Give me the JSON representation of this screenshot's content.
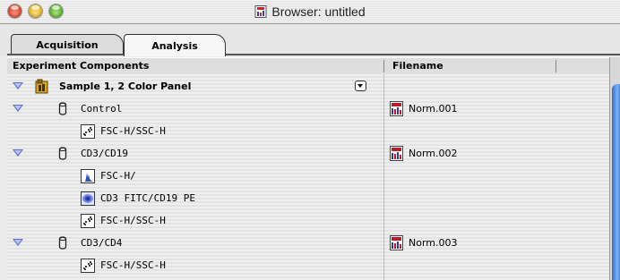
{
  "window": {
    "title": "Browser: untitled",
    "controls": [
      "close",
      "minimize",
      "zoom"
    ]
  },
  "tabs": [
    {
      "label": "Acquisition",
      "selected": false
    },
    {
      "label": "Analysis",
      "selected": true
    }
  ],
  "table": {
    "columns": [
      "Experiment Components",
      "Filename"
    ],
    "rows": [
      {
        "label": "Sample 1, 2 Color Panel",
        "icon": "experiment-folder-icon",
        "disclosure": true,
        "bold": true,
        "has_popup": true,
        "file": ""
      },
      {
        "label": "Control",
        "icon": "tube-icon",
        "disclosure": true,
        "file": "Norm.001",
        "file_icon": "fcs-file-icon"
      },
      {
        "label": "FSC-H/SSC-H",
        "icon": "dot-plot-icon",
        "disclosure": false,
        "file": ""
      },
      {
        "label": "CD3/CD19",
        "icon": "tube-icon",
        "disclosure": true,
        "file": "Norm.002",
        "file_icon": "fcs-file-icon"
      },
      {
        "label": "FSC-H/",
        "icon": "histogram-icon",
        "disclosure": false,
        "file": ""
      },
      {
        "label": "CD3 FITC/CD19 PE",
        "icon": "contour-plot-icon",
        "disclosure": false,
        "file": ""
      },
      {
        "label": "FSC-H/SSC-H",
        "icon": "dot-plot-icon",
        "disclosure": false,
        "file": ""
      },
      {
        "label": "CD3/CD4",
        "icon": "tube-icon",
        "disclosure": true,
        "file": "Norm.003",
        "file_icon": "fcs-file-icon"
      },
      {
        "label": "FSC-H/SSC-H",
        "icon": "dot-plot-icon",
        "disclosure": false,
        "file": ""
      }
    ]
  }
}
